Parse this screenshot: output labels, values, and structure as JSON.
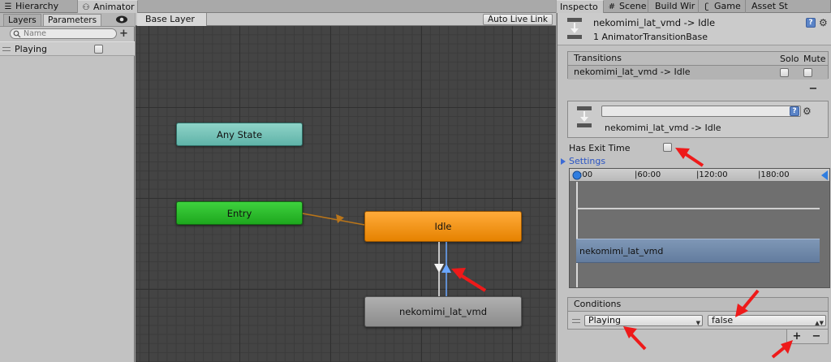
{
  "tabs_left": [
    {
      "label": "Hierarchy",
      "icon": "hierarchy-icon"
    },
    {
      "label": "Animator",
      "icon": "animator-icon"
    }
  ],
  "tabs_right": [
    {
      "label": "Inspecto",
      "icon": "inspector-icon"
    },
    {
      "label": "Scene",
      "icon": "scene-icon"
    },
    {
      "label": "Build Wir",
      "icon": "build-icon"
    },
    {
      "label": "Game",
      "icon": "game-icon"
    },
    {
      "label": "Asset St",
      "icon": "asset-store-icon"
    }
  ],
  "parameters_panel": {
    "layers_tab": "Layers",
    "parameters_tab": "Parameters",
    "search_placeholder": "Name",
    "add_label": "+",
    "param": {
      "name": "Playing",
      "value": false
    }
  },
  "graph": {
    "breadcrumb": "Base Layer",
    "auto_live_link": "Auto Live Link",
    "states": {
      "any_state": "Any State",
      "entry": "Entry",
      "idle": "Idle",
      "nekomimi": "nekomimi_lat_vmd"
    }
  },
  "inspector": {
    "title": "nekomimi_lat_vmd -> Idle",
    "subtitle": "1 AnimatorTransitionBase",
    "help": "?",
    "transitions_header": "Transitions",
    "solo_label": "Solo",
    "mute_label": "Mute",
    "transition_item": "nekomimi_lat_vmd -> Idle",
    "minus_label": "−",
    "detail_name_value": "",
    "detail_label": "nekomimi_lat_vmd -> Idle",
    "has_exit_time_label": "Has Exit Time",
    "has_exit_time": false,
    "settings_label": "Settings",
    "ruler_ticks": [
      ":00",
      "|60:00",
      "|120:00",
      "|180:00"
    ],
    "clip_label": "nekomimi_lat_vmd",
    "conditions_header": "Conditions",
    "condition_param": "Playing",
    "condition_value": "false",
    "plus_label": "+",
    "minus2_label": "−"
  },
  "colors": {
    "any_state": "#6fc1b6",
    "entry": "#27b827",
    "idle": "#f2920f",
    "nekomimi": "#9c9c9c",
    "arrow": "#ee1a1a",
    "clip": "#7088aa"
  }
}
